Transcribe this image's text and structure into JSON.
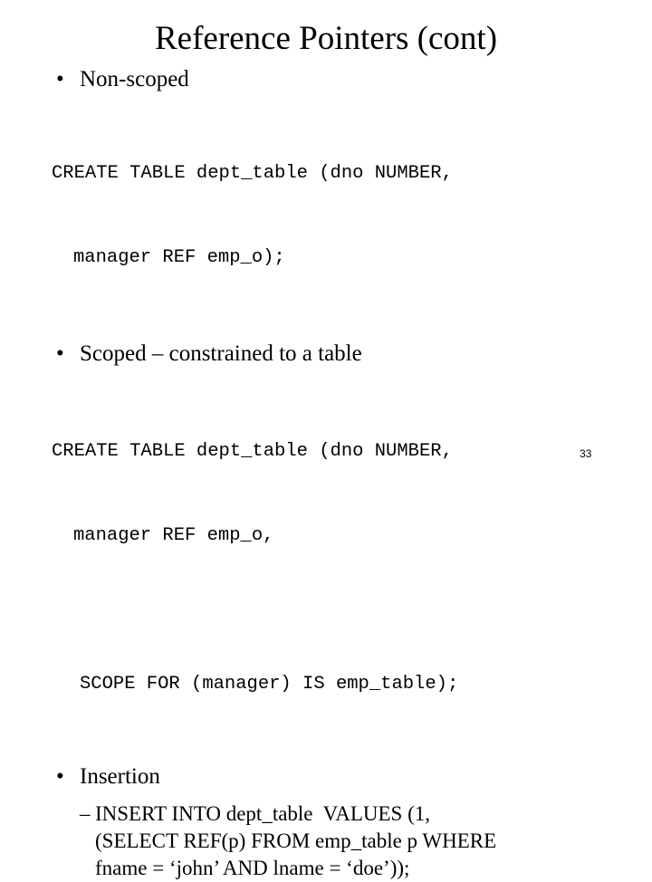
{
  "slide": {
    "title": "Reference Pointers (cont)",
    "page_number": "33",
    "bullet_glyph": "•",
    "dash_glyph": "–",
    "sections": [
      {
        "bullet": "Non-scoped",
        "code": [
          "CREATE TABLE dept_table (dno NUMBER,",
          "manager REF emp_o);"
        ]
      },
      {
        "bullet": "Scoped – constrained to a table",
        "code": [
          "CREATE TABLE dept_table (dno NUMBER,",
          "manager REF emp_o,",
          "SCOPE FOR (manager) IS emp_table);"
        ]
      },
      {
        "bullet": "Insertion",
        "sub_bullet": [
          "INSERT INTO dept_table  VALUES (1,",
          "(SELECT REF(p) FROM emp_table p WHERE",
          "fname = ‘john’ AND lname = ‘doe’));"
        ]
      }
    ]
  }
}
